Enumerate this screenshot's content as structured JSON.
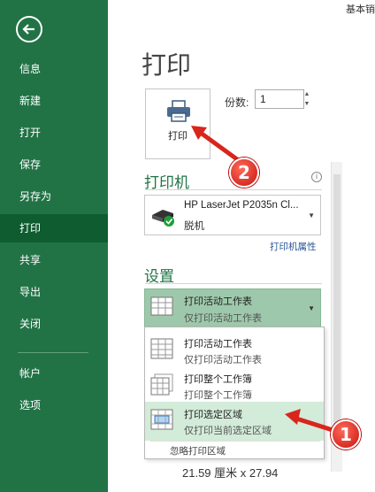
{
  "app": {
    "doc_title": "基本销"
  },
  "sidebar": {
    "back": "back",
    "items": [
      {
        "label": "信息"
      },
      {
        "label": "新建"
      },
      {
        "label": "打开"
      },
      {
        "label": "保存"
      },
      {
        "label": "另存为"
      },
      {
        "label": "打印"
      },
      {
        "label": "共享"
      },
      {
        "label": "导出"
      },
      {
        "label": "关闭"
      },
      {
        "label": "帐户"
      },
      {
        "label": "选项"
      }
    ],
    "active": "打印"
  },
  "main": {
    "title": "打印",
    "print_button": "打印",
    "copies_label": "份数:",
    "copies_value": "1",
    "printer_heading": "打印机",
    "printer_name": "HP LaserJet P2035n Cl...",
    "printer_status": "脱机",
    "printer_properties": "打印机属性",
    "settings_heading": "设置",
    "selected_option": {
      "title": "打印活动工作表",
      "subtitle": "仅打印活动工作表"
    },
    "dropdown_options": [
      {
        "title": "打印活动工作表",
        "subtitle": "仅打印活动工作表"
      },
      {
        "title": "打印整个工作簿",
        "subtitle": "打印整个工作簿"
      },
      {
        "title": "打印选定区域",
        "subtitle": "仅打印当前选定区域"
      }
    ],
    "ignore_print_area": "忽略打印区域",
    "paper_size": "21.59 厘米 x 27.94"
  },
  "annotations": {
    "marker_1": "1",
    "marker_2": "2"
  },
  "colors": {
    "sidebar": "#217346",
    "sidebar_active": "#0e5c30",
    "accent": "#217346",
    "marker": "#d8261d"
  }
}
